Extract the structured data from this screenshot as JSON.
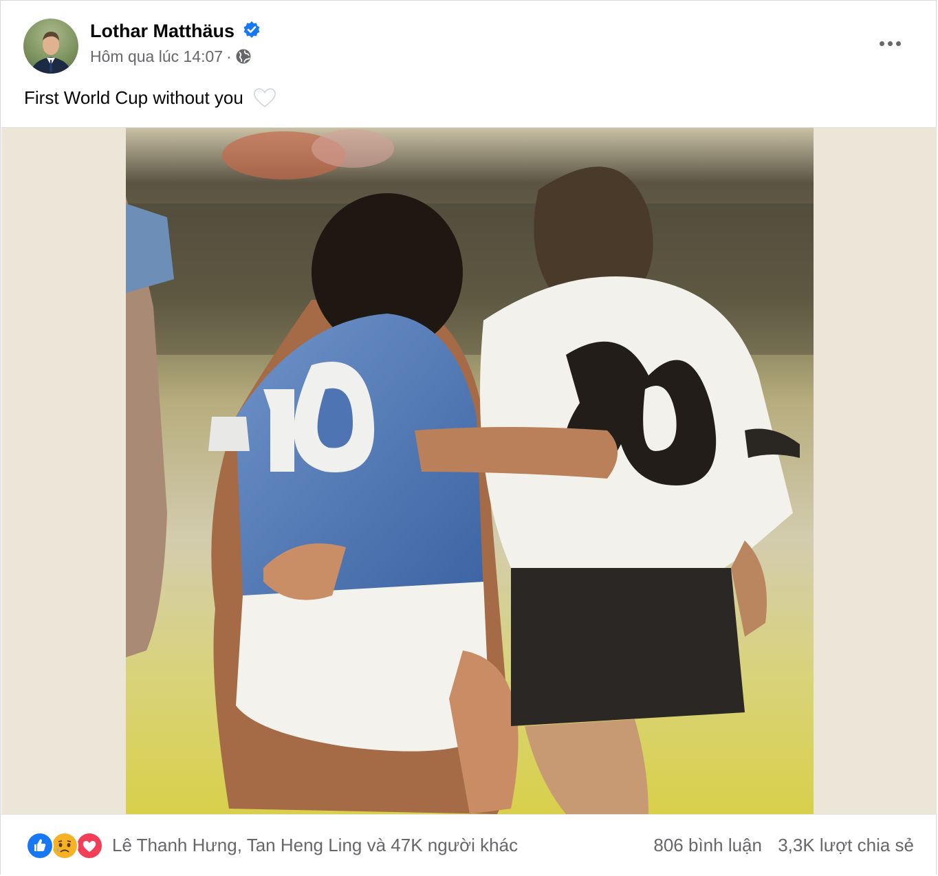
{
  "post": {
    "author": "Lothar Matthäus",
    "time": "Hôm qua lúc 14:07",
    "meta_separator": "·",
    "privacy_icon": "globe-icon",
    "caption": "First World Cup without you",
    "caption_emoji": "white-heart"
  },
  "reactions": {
    "icons": [
      "like-reaction-icon",
      "sad-reaction-icon",
      "love-reaction-icon"
    ],
    "summary": "Lê Thanh Hưng, Tan Heng Ling và 47K người khác",
    "comments": "806 bình luận",
    "shares": "3,3K lượt chia sẻ"
  },
  "colors": {
    "verified": "#1877f2",
    "like": "#1877f2",
    "love": "#f33e58",
    "sad": "#f7b125",
    "media_background": "#ebe6d8"
  }
}
